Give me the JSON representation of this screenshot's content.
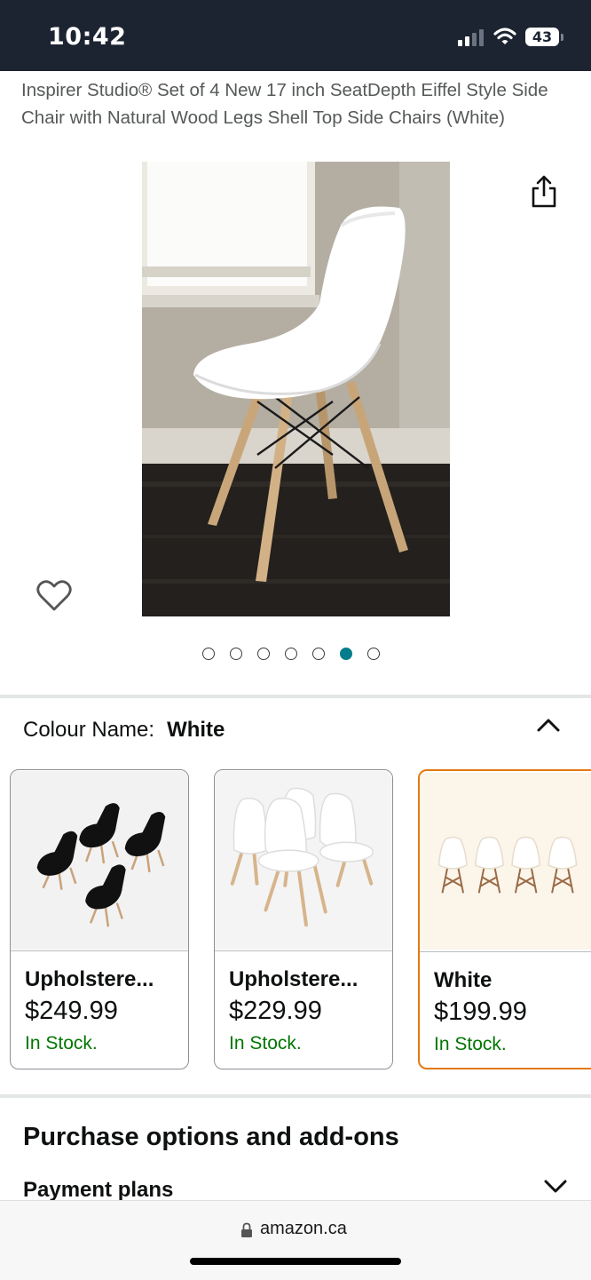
{
  "status_bar": {
    "time": "10:42",
    "battery": "43"
  },
  "product": {
    "title": "Inspirer Studio® Set of 4 New 17 inch SeatDepth Eiffel Style Side Chair with Natural Wood Legs Shell Top Side Chairs (White)"
  },
  "gallery": {
    "image_count": 7,
    "active_index": 5
  },
  "variation": {
    "label": "Colour Name:",
    "value": "White"
  },
  "variants": [
    {
      "name": "Upholstere...",
      "price": "$249.99",
      "stock": "In Stock.",
      "selected": false
    },
    {
      "name": "Upholstere...",
      "price": "$229.99",
      "stock": "In Stock.",
      "selected": false
    },
    {
      "name": "White",
      "price": "$199.99",
      "stock": "In Stock.",
      "selected": true
    }
  ],
  "purchase_options": {
    "heading": "Purchase options and add-ons",
    "payment_plans": "Payment plans"
  },
  "browser": {
    "url": "amazon.ca"
  },
  "colors": {
    "status_bar_bg": "#1c2431",
    "in_stock": "#007600",
    "selected_border": "#e47911",
    "active_dot": "#067d8c"
  },
  "icons": [
    "share-icon",
    "heart-icon",
    "chevron-up-icon",
    "chevron-down-icon",
    "lock-icon",
    "wifi-icon",
    "signal-icon",
    "battery-icon"
  ]
}
